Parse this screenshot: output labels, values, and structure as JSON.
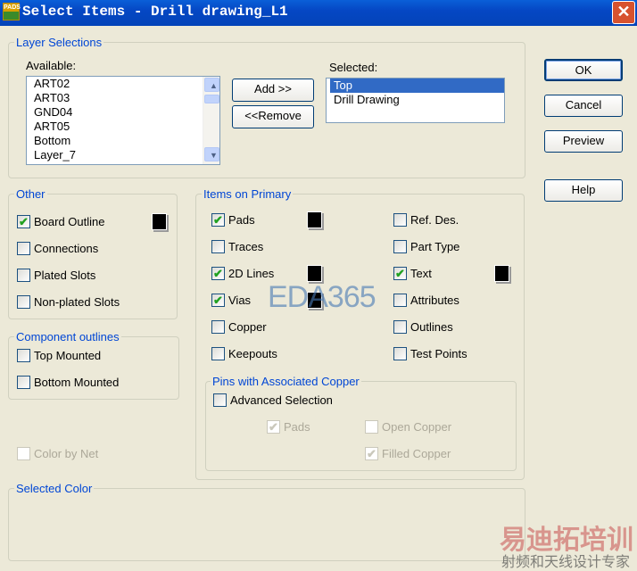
{
  "window": {
    "title": "Select Items - Drill drawing_L1",
    "icon": "pads-logo-icon",
    "icon_text": "PADS"
  },
  "layer_selections": {
    "legend": "Layer Selections",
    "available_label": "Available:",
    "available": [
      "ART02",
      "ART03",
      "GND04",
      "ART05",
      "Bottom",
      "Layer_7"
    ],
    "selected_label": "Selected:",
    "selected": [
      "Top",
      "Drill Drawing"
    ],
    "selected_highlight": "Top",
    "add_label": "Add >>",
    "remove_label": "<<Remove"
  },
  "buttons": {
    "ok": "OK",
    "cancel": "Cancel",
    "preview": "Preview",
    "help": "Help"
  },
  "other": {
    "legend": "Other",
    "items": [
      {
        "label": "Board Outline",
        "checked": true,
        "color": "#000000"
      },
      {
        "label": "Connections",
        "checked": false
      },
      {
        "label": "Plated Slots",
        "checked": false
      },
      {
        "label": "Non-plated Slots",
        "checked": false
      }
    ]
  },
  "component_outlines": {
    "legend": "Component outlines",
    "items": [
      {
        "label": "Top Mounted",
        "checked": false
      },
      {
        "label": "Bottom Mounted",
        "checked": false
      }
    ]
  },
  "color_by_net": {
    "label": "Color by Net",
    "checked": false,
    "disabled": true
  },
  "items_on_primary": {
    "legend": "Items on Primary",
    "left": [
      {
        "label": "Pads",
        "checked": true,
        "color": "#000000"
      },
      {
        "label": "Traces",
        "checked": false
      },
      {
        "label": "2D Lines",
        "checked": true,
        "color": "#000000"
      },
      {
        "label": "Vias",
        "checked": true,
        "color": "#000000"
      },
      {
        "label": "Copper",
        "checked": false
      },
      {
        "label": "Keepouts",
        "checked": false
      }
    ],
    "right": [
      {
        "label": "Ref. Des.",
        "checked": false
      },
      {
        "label": "Part Type",
        "checked": false
      },
      {
        "label": "Text",
        "checked": true,
        "color": "#000000"
      },
      {
        "label": "Attributes",
        "checked": false
      },
      {
        "label": "Outlines",
        "checked": false
      },
      {
        "label": "Test Points",
        "checked": false
      }
    ]
  },
  "pins": {
    "legend": "Pins with Associated Copper",
    "advanced": {
      "label": "Advanced Selection",
      "checked": false
    },
    "pads": {
      "label": "Pads",
      "checked": true
    },
    "open_copper": {
      "label": "Open Copper",
      "checked": false
    },
    "filled_copper": {
      "label": "Filled Copper",
      "checked": true
    }
  },
  "selected_color": {
    "legend": "Selected Color"
  },
  "watermarks": {
    "eda": "EDA365",
    "cn_title": "易迪拓培训",
    "cn_sub": "射频和天线设计专家"
  }
}
